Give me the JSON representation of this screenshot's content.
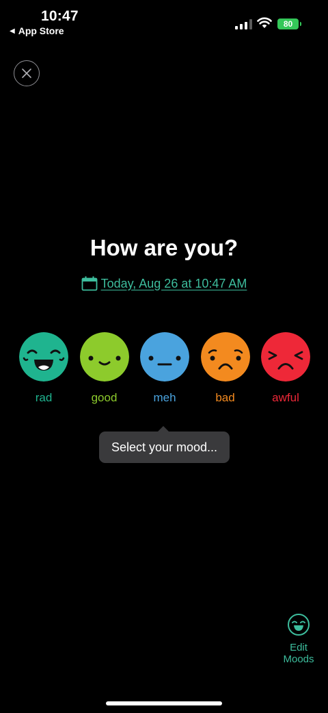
{
  "status_bar": {
    "time": "10:47",
    "back_app": "App Store",
    "battery": "80"
  },
  "colors": {
    "accent": "#3dbd9d",
    "rad": "#1fb48f",
    "good": "#8dcb2c",
    "meh": "#4aa3de",
    "bad": "#f38a1f",
    "awful": "#ee2838"
  },
  "header": {
    "close_icon": "close-icon",
    "title": "How are you?",
    "date_label": "Today, Aug 26 at 10:47 AM",
    "date_icon": "calendar-icon"
  },
  "moods": [
    {
      "label": "rad",
      "icon": "rad-face-icon"
    },
    {
      "label": "good",
      "icon": "good-face-icon"
    },
    {
      "label": "meh",
      "icon": "meh-face-icon"
    },
    {
      "label": "bad",
      "icon": "bad-face-icon"
    },
    {
      "label": "awful",
      "icon": "awful-face-icon"
    }
  ],
  "tooltip": {
    "text": "Select your mood..."
  },
  "edit_moods": {
    "label_line1": "Edit",
    "label_line2": "Moods",
    "icon": "edit-moods-face-icon"
  }
}
